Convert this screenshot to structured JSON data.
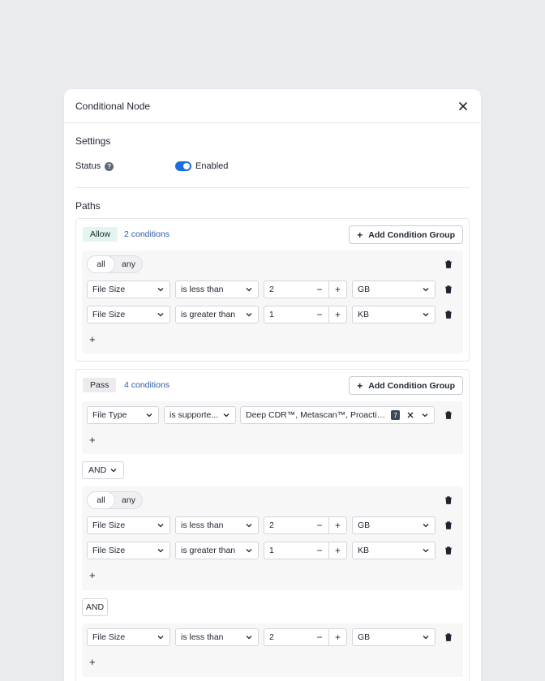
{
  "modal": {
    "title": "Conditional Node"
  },
  "settings": {
    "title": "Settings",
    "status_label": "Status",
    "toggle_label": "Enabled",
    "toggle_on": true
  },
  "paths": {
    "title": "Paths",
    "allow": {
      "badge": "Allow",
      "count": "2 conditions",
      "add_group": "Add Condition Group",
      "group": {
        "mode_all": "all",
        "mode_any": "any",
        "rows": [
          {
            "field": "File Size",
            "op": "is less than",
            "value": "2",
            "unit": "GB"
          },
          {
            "field": "File Size",
            "op": "is greater than",
            "value": "1",
            "unit": "KB"
          }
        ]
      }
    },
    "pass": {
      "badge": "Pass",
      "count": "4 conditions",
      "add_group": "Add Condition Group",
      "first_row": {
        "field": "File Type",
        "op": "is supporte...",
        "value": "Deep CDR™, Metascan™, Proactive DL...",
        "badge": "7"
      },
      "and1": "AND",
      "group": {
        "mode_all": "all",
        "mode_any": "any",
        "rows": [
          {
            "field": "File Size",
            "op": "is less than",
            "value": "2",
            "unit": "GB"
          },
          {
            "field": "File Size",
            "op": "is greater than",
            "value": "1",
            "unit": "KB"
          }
        ]
      },
      "and2": "AND",
      "last_row": {
        "field": "File Size",
        "op": "is less than",
        "value": "2",
        "unit": "GB"
      }
    }
  },
  "symbols": {
    "minus": "−",
    "plus": "+",
    "add": "+"
  },
  "colors": {
    "accent": "#1d6fe0",
    "allow_bg": "#e2f6ef",
    "link": "#2d5aa8"
  }
}
